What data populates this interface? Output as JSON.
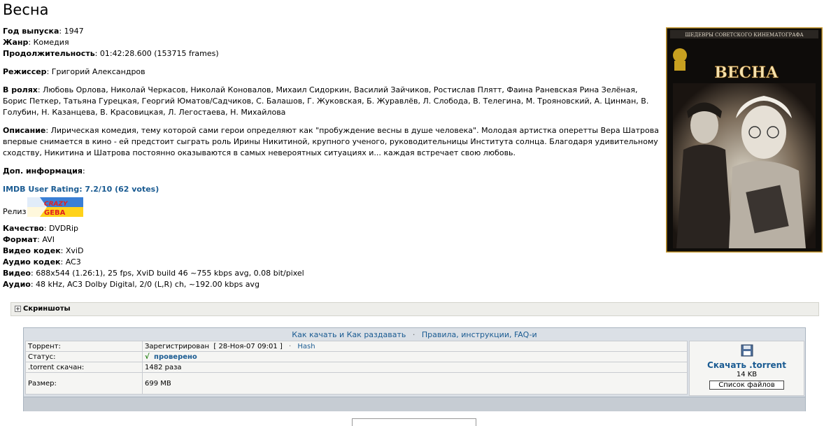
{
  "page_title": "Весна",
  "info": {
    "year_label": "Год выпуска",
    "year": "1947",
    "genre_label": "Жанр",
    "genre": "Комедия",
    "duration_label": "Продолжительность",
    "duration": "01:42:28.600 (153715 frames)",
    "director_label": "Режиссер",
    "director": "Григорий Александров",
    "cast_label": "В ролях",
    "cast": "Любовь Орлова, Николай Черкасов, Николай Коновалов, Михаил Сидоркин, Василий Зайчиков, Ростислав Плятт, Фаина Раневская Рина Зелёная, Борис Петкер, Татьяна Гурецкая, Георгий Юматов/Садчиков, С. Балашов, Г. Жуковская, Б. Журавлёв, Л. Слобода, В. Телегина, М. Трояновский, А. Цинман, В. Голубин, Н. Казанцева, В. Красовицкая, Л. Легостаева, Н. Михайлова",
    "description_label": "Описание",
    "description": "Лирическая комедия, тему которой сами герои определяют как \"пробуждение весны в душе человека\". Молодая артистка оперетты Вера Шатрова впервые снимается в кино - ей предстоит сыграть роль Ирины Никитиной, крупного ученого, руководительницы Института солнца. Благодаря удивительному сходству, Никитина и Шатрова постоянно оказываются в самых невероятных ситуациях и... каждая встречает свою любовь.",
    "extra_label": "Доп. информация",
    "imdb": "IMDB User Rating: 7.2/10 (62 votes)",
    "release_label": "Релиз",
    "release_logo_text": "GEBA",
    "quality_label": "Качество",
    "quality": "DVDRip",
    "format_label": "Формат",
    "format": "AVI",
    "vcodec_label": "Видео кодек",
    "vcodec": "XviD",
    "acodec_label": "Аудио кодек",
    "acodec": "AC3",
    "video_label": "Видео",
    "video": "688x544 (1.26:1), 25 fps, XviD build 46 ~755 kbps avg, 0.08 bit/pixel",
    "audio_label": "Аудио",
    "audio": "48 kHz, AC3 Dolby Digital, 2/0 (L,R) ch, ~192.00 kbps avg"
  },
  "poster": {
    "header_text": "ШЕДЕВРЫ СОВЕТСКОГО КИНЕМАТОГРАФА",
    "title": "ВЕСНА"
  },
  "spoiler": {
    "label": "Скриншоты"
  },
  "torrent": {
    "link1": "Как качать и Как раздавать",
    "link2": "Правила, инструкции, FAQ-и",
    "rows": {
      "torrent_label": "Торрент:",
      "torrent_value": "Зарегистрирован",
      "torrent_date": "[ 28-Ноя-07 09:01 ]",
      "hash": "Hash",
      "status_label": "Статус:",
      "status_check": "√",
      "status_value": "проверено",
      "downloaded_label": ".torrent скачан:",
      "downloaded_value": "1482 раза",
      "size_label": "Размер:",
      "size_value": "699 MB"
    },
    "download_link": "Скачать .torrent",
    "download_size": "14 KB",
    "filelist_button": "Список файлов"
  }
}
